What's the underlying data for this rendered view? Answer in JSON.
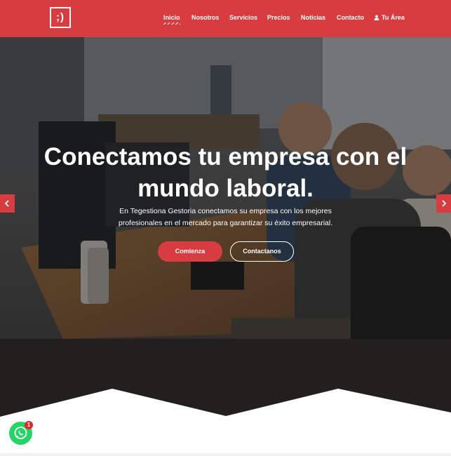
{
  "header": {
    "logo_text": ";)",
    "background": "#d73d40",
    "nav": [
      {
        "label": "Inicio",
        "active": true
      },
      {
        "label": "Nosotros"
      },
      {
        "label": "Servicios"
      },
      {
        "label": "Precios"
      },
      {
        "label": "Noticias"
      },
      {
        "label": "Contacto"
      },
      {
        "label": "Tu Área",
        "icon": "user-icon"
      }
    ]
  },
  "hero": {
    "headline_line1": "Conectamos tu empresa con el",
    "headline_line2": "mundo laboral.",
    "subtext_line1": "En Tegestiona Gestoria conectamos su empresa con los mejores",
    "subtext_line2": "profesionales en el mercado para garantizar su éxito empresarial.",
    "primary_button": "Comienza",
    "secondary_button": "Contactanos",
    "prev_icon": "chevron-left-icon",
    "next_icon": "chevron-right-icon",
    "accent": "#d73d40"
  },
  "whatsapp": {
    "icon": "whatsapp-icon",
    "badge_count": "1",
    "color": "#25d366"
  }
}
